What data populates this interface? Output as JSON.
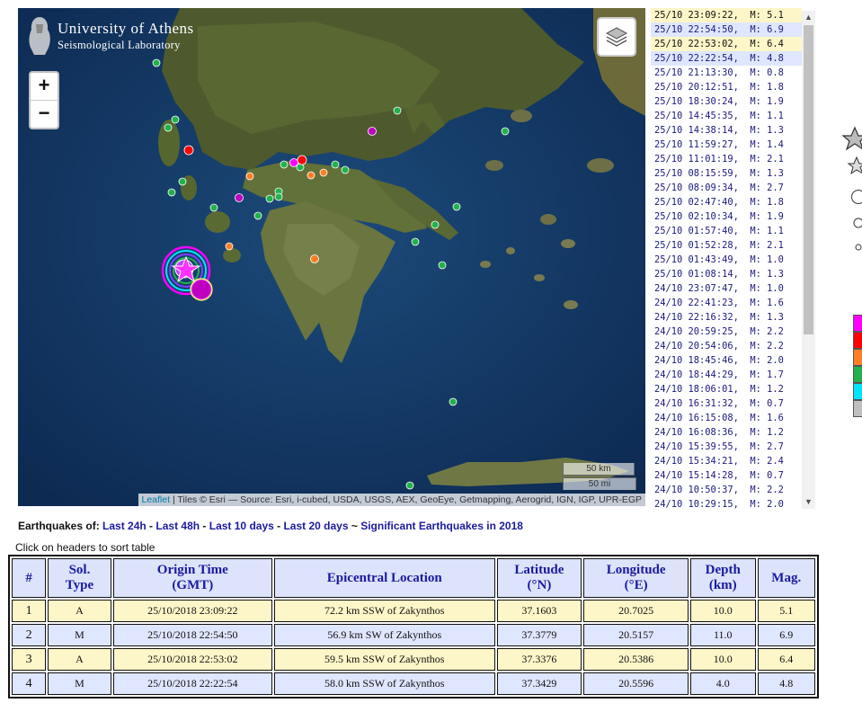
{
  "header": {
    "logo_line1": "University of Athens",
    "logo_line2": "Seismological Laboratory"
  },
  "map": {
    "zoom_in": "+",
    "zoom_out": "−",
    "scale_km": "50 km",
    "scale_mi": "50 mi",
    "attribution_link": "Leaflet",
    "attribution_text": " | Tiles © Esri — Source: Esri, i-cubed, USDA, USGS, AEX, GeoEye, Getmapping, Aerogrid, IGN, IGP, UPR-EGP",
    "layers_icon": "layers-icon"
  },
  "eq_list": [
    {
      "text": "25/10 23:09:22,  M: 5.1",
      "style": "y"
    },
    {
      "text": "25/10 22:54:50,  M: 6.9",
      "style": "b"
    },
    {
      "text": "25/10 22:53:02,  M: 6.4",
      "style": "y"
    },
    {
      "text": "25/10 22:22:54,  M: 4.8",
      "style": "b"
    },
    {
      "text": "25/10 21:13:30,  M: 0.8",
      "style": ""
    },
    {
      "text": "25/10 20:12:51,  M: 1.8",
      "style": ""
    },
    {
      "text": "25/10 18:30:24,  M: 1.9",
      "style": ""
    },
    {
      "text": "25/10 14:45:35,  M: 1.1",
      "style": ""
    },
    {
      "text": "25/10 14:38:14,  M: 1.3",
      "style": ""
    },
    {
      "text": "25/10 11:59:27,  M: 1.4",
      "style": ""
    },
    {
      "text": "25/10 11:01:19,  M: 2.1",
      "style": ""
    },
    {
      "text": "25/10 08:15:59,  M: 1.3",
      "style": ""
    },
    {
      "text": "25/10 08:09:34,  M: 2.7",
      "style": ""
    },
    {
      "text": "25/10 02:47:40,  M: 1.8",
      "style": ""
    },
    {
      "text": "25/10 02:10:34,  M: 1.9",
      "style": ""
    },
    {
      "text": "25/10 01:57:40,  M: 1.1",
      "style": ""
    },
    {
      "text": "25/10 01:52:28,  M: 2.1",
      "style": ""
    },
    {
      "text": "25/10 01:43:49,  M: 1.0",
      "style": ""
    },
    {
      "text": "25/10 01:08:14,  M: 1.3",
      "style": ""
    },
    {
      "text": "24/10 23:07:47,  M: 1.0",
      "style": ""
    },
    {
      "text": "24/10 22:41:23,  M: 1.6",
      "style": ""
    },
    {
      "text": "24/10 22:16:32,  M: 1.3",
      "style": ""
    },
    {
      "text": "24/10 20:59:25,  M: 2.2",
      "style": ""
    },
    {
      "text": "24/10 20:54:06,  M: 2.2",
      "style": ""
    },
    {
      "text": "24/10 18:45:46,  M: 2.0",
      "style": ""
    },
    {
      "text": "24/10 18:44:29,  M: 1.7",
      "style": ""
    },
    {
      "text": "24/10 18:06:01,  M: 1.2",
      "style": ""
    },
    {
      "text": "24/10 16:31:32,  M: 0.7",
      "style": ""
    },
    {
      "text": "24/10 16:15:08,  M: 1.6",
      "style": ""
    },
    {
      "text": "24/10 16:08:36,  M: 1.2",
      "style": ""
    },
    {
      "text": "24/10 15:39:55,  M: 2.7",
      "style": ""
    },
    {
      "text": "24/10 15:34:21,  M: 2.4",
      "style": ""
    },
    {
      "text": "24/10 15:14:28,  M: 0.7",
      "style": ""
    },
    {
      "text": "24/10 10:50:37,  M: 2.2",
      "style": ""
    },
    {
      "text": "24/10 10:29:15,  M: 2.0",
      "style": ""
    }
  ],
  "legend": {
    "colors": [
      "#ff00ff",
      "#ff0000",
      "#ff7f27",
      "#22b14c",
      "#00e5ff",
      "#bfbfbf"
    ]
  },
  "links": {
    "prefix": "Earthquakes of: ",
    "items": [
      "Last 24h",
      "Last 48h",
      "Last 10 days",
      "Last 20 days"
    ],
    "sep": " - ",
    "tilde": " ~ ",
    "significant": "Significant Earthquakes in 2018"
  },
  "hint": "Click on headers to sort table",
  "table": {
    "headers": [
      {
        "l1": "#",
        "l2": ""
      },
      {
        "l1": "Sol.",
        "l2": "Type"
      },
      {
        "l1": "Origin Time",
        "l2": "(GMT)"
      },
      {
        "l1": "Epicentral Location",
        "l2": ""
      },
      {
        "l1": "Latitude",
        "l2": "(°N)"
      },
      {
        "l1": "Longitude",
        "l2": "(°E)"
      },
      {
        "l1": "Depth",
        "l2": "(km)"
      },
      {
        "l1": "Mag.",
        "l2": ""
      }
    ],
    "rows": [
      {
        "n": "1",
        "type": "A",
        "time": "25/10/2018 23:09:22",
        "loc": "72.2 km SSW of Zakynthos",
        "lat": "37.1603",
        "lon": "20.7025",
        "depth": "10.0",
        "mag": "5.1",
        "style": "y"
      },
      {
        "n": "2",
        "type": "M",
        "time": "25/10/2018 22:54:50",
        "loc": "56.9 km SW of Zakynthos",
        "lat": "37.3779",
        "lon": "20.5157",
        "depth": "11.0",
        "mag": "6.9",
        "style": "b"
      },
      {
        "n": "3",
        "type": "A",
        "time": "25/10/2018 22:53:02",
        "loc": "59.5 km SSW of Zakynthos",
        "lat": "37.3376",
        "lon": "20.5386",
        "depth": "10.0",
        "mag": "6.4",
        "style": "y"
      },
      {
        "n": "4",
        "type": "M",
        "time": "25/10/2018 22:22:54",
        "loc": "58.0 km SSW of Zakynthos",
        "lat": "37.3429",
        "lon": "20.5596",
        "depth": "4.0",
        "mag": "4.8",
        "style": "b"
      }
    ]
  }
}
